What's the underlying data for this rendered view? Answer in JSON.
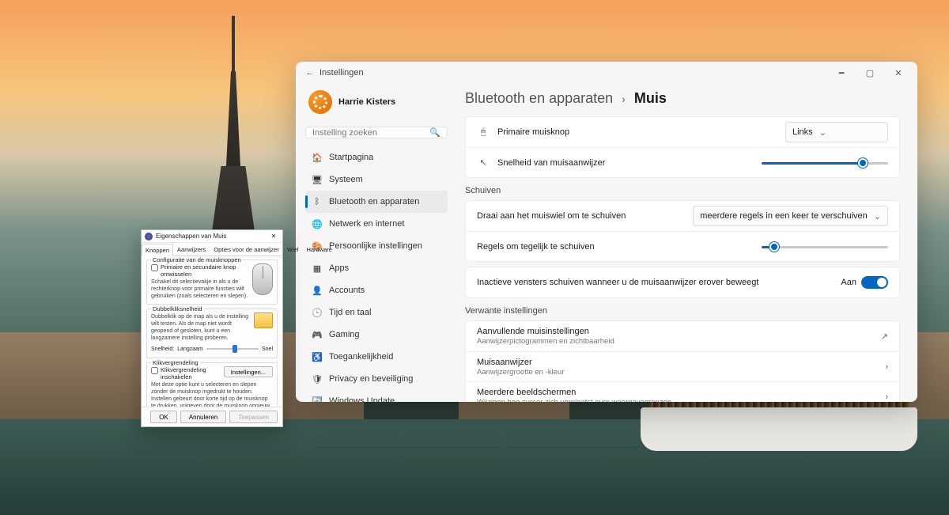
{
  "settings": {
    "appTitle": "Instellingen",
    "profileName": "Harrie Kisters",
    "searchPlaceholder": "Instelling zoeken",
    "nav": [
      {
        "icon": "🏠",
        "label": "Startpagina"
      },
      {
        "icon": "🖥",
        "label": "Systeem"
      },
      {
        "icon": "ᛒ",
        "label": "Bluetooth en apparaten",
        "selected": true
      },
      {
        "icon": "🌐",
        "label": "Netwerk en internet"
      },
      {
        "icon": "🎨",
        "label": "Persoonlijke instellingen"
      },
      {
        "icon": "▦",
        "label": "Apps"
      },
      {
        "icon": "👤",
        "label": "Accounts"
      },
      {
        "icon": "🕒",
        "label": "Tijd en taal"
      },
      {
        "icon": "🎮",
        "label": "Gaming"
      },
      {
        "icon": "♿",
        "label": "Toegankelijkheid"
      },
      {
        "icon": "🛡",
        "label": "Privacy en beveiliging"
      },
      {
        "icon": "🔄",
        "label": "Windows Update"
      }
    ],
    "breadcrumb": {
      "parent": "Bluetooth en apparaten",
      "current": "Muis"
    },
    "primaryButton": {
      "label": "Primaire muisknop",
      "value": "Links"
    },
    "pointerSpeed": {
      "label": "Snelheid van muisaanwijzer",
      "value": 80
    },
    "scrollingHeader": "Schuiven",
    "wheelScroll": {
      "label": "Draai aan het muiswiel om te schuiven",
      "value": "meerdere regels in een keer te verschuiven"
    },
    "linesScroll": {
      "label": "Regels om tegelijk te schuiven",
      "value": 10
    },
    "inactiveScroll": {
      "label": "Inactieve vensters schuiven wanneer u de muisaanwijzer erover beweegt",
      "state": "Aan",
      "on": true
    },
    "relatedHeader": "Verwante instellingen",
    "related": [
      {
        "title": "Aanvullende muisinstellingen",
        "sub": "Aanwijzerpictogrammen en zichtbaarheid",
        "trail": "↗"
      },
      {
        "title": "Muisaanwijzer",
        "sub": "Aanwijzergrootte en -kleur",
        "trail": "›"
      },
      {
        "title": "Meerdere beeldschermen",
        "sub": "Wijzigen hoe cursor zich verplaatst over weergavegrenzen",
        "trail": "›"
      }
    ]
  },
  "props": {
    "title": "Eigenschappen van Muis",
    "tabs": [
      "Knoppen",
      "Aanwijzers",
      "Opties voor de aanwijzer",
      "Wiel",
      "Hardware"
    ],
    "activeTab": 0,
    "group1": {
      "legend": "Configuratie van de muisknoppen",
      "checkbox": "Primaire en secundaire knop omwisselen",
      "desc": "Schakel dit selectievakje in als u de rechterknop voor primaire functies wilt gebruiken (zoals selecteren en slepen)."
    },
    "group2": {
      "legend": "Dubbelkliksnelheid",
      "desc": "Dubbelklik op de map als u de instelling wilt testen. Als de map niet wordt geopend of gesloten, kunt u een langzamere instelling proberen.",
      "speedLabel": "Snelheid:",
      "slow": "Langzaam",
      "fast": "Snel",
      "value": 55
    },
    "group3": {
      "legend": "Klikvergrendeling",
      "checkbox": "Klikvergrendeling inschakelen",
      "btn": "Instellingen...",
      "desc": "Met deze optie kunt u selecteren en slepen zonder de muisknop ingedrukt te houden. Instellen gebeurt door korte tijd op de muisknop te drukken, vrijgeven door de muisknop opnieuw in te drukken."
    },
    "buttons": {
      "ok": "OK",
      "cancel": "Annuleren",
      "apply": "Toepassen"
    }
  }
}
